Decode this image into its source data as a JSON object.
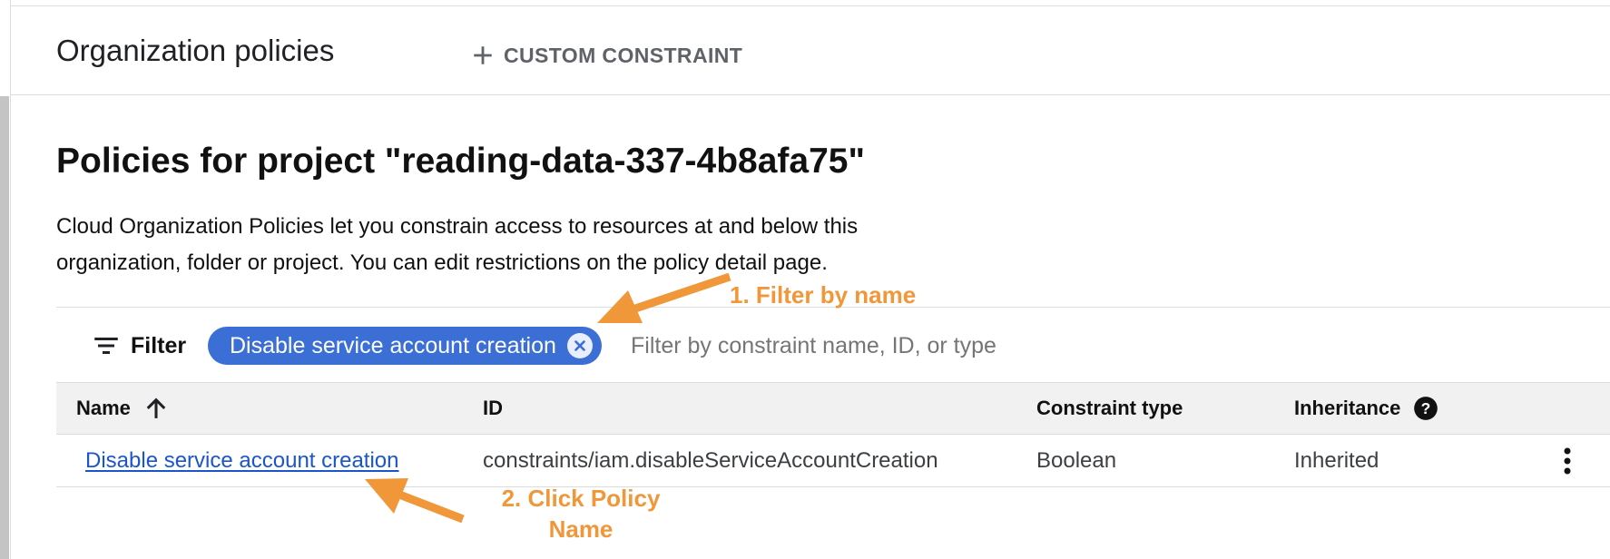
{
  "header": {
    "title": "Organization policies",
    "custom_constraint_label": "CUSTOM CONSTRAINT"
  },
  "main": {
    "heading": "Policies for project \"reading-data-337-4b8afa75\"",
    "description": "Cloud Organization Policies let you constrain access to resources at and below this organization, folder or project. You can edit restrictions on the policy detail page."
  },
  "filter": {
    "label": "Filter",
    "chip_label": "Disable service account creation",
    "placeholder": "Filter by constraint name, ID, or type"
  },
  "table": {
    "columns": [
      "Name",
      "ID",
      "Constraint type",
      "Inheritance"
    ],
    "rows": [
      {
        "name": "Disable service account creation",
        "id": "constraints/iam.disableServiceAccountCreation",
        "constraint_type": "Boolean",
        "inheritance": "Inherited"
      }
    ]
  },
  "annotations": {
    "step1": "1. Filter by name",
    "step2_line1": "2. Click Policy",
    "step2_line2": "Name"
  },
  "colors": {
    "chip": "#3b6fd6",
    "link": "#1a56c9",
    "annotation": "#f0973a"
  },
  "icons": [
    "plus-icon",
    "filter-icon",
    "close-circle-icon",
    "arrow-up-icon",
    "help-icon",
    "more-vert-icon"
  ]
}
